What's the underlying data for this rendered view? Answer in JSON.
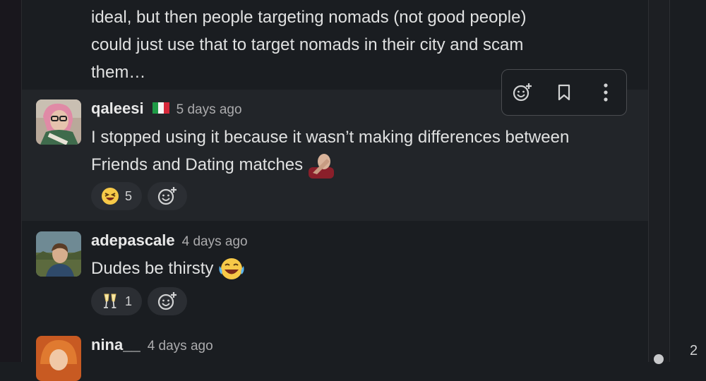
{
  "prev_message": {
    "lines": [
      "ideal, but then people targeting nomads (not good people)",
      "could just use that to target nomads in their city and scam",
      "them…"
    ]
  },
  "messages": [
    {
      "username": "qaleesi",
      "flag": "italy-flag",
      "time": "5 days ago",
      "lines": [
        "I stopped using it because it wasn’t making differences between",
        "Friends and Dating matches"
      ],
      "inline_emoji": "facepalm-emoji",
      "reactions": [
        {
          "icon": "laughing-emoji",
          "count": "5"
        }
      ]
    },
    {
      "username": "adepascale",
      "time": "4 days ago",
      "lines": [
        "Dudes be thirsty"
      ],
      "inline_emoji": "tears-of-joy-emoji",
      "reactions": [
        {
          "icon": "champagne-glasses-emoji",
          "count": "1"
        }
      ]
    },
    {
      "username": "nina__",
      "time": "4 days ago"
    }
  ],
  "toolbar": {
    "icons": [
      "add-reaction-icon",
      "bookmark-icon",
      "more-actions-icon"
    ]
  },
  "pager": {
    "current": "2"
  },
  "colors": {
    "background": "#1a1d21",
    "hover_row": "#222529",
    "pill": "#2b2e33",
    "text": "#e0e1e1",
    "muted": "#ababad"
  }
}
